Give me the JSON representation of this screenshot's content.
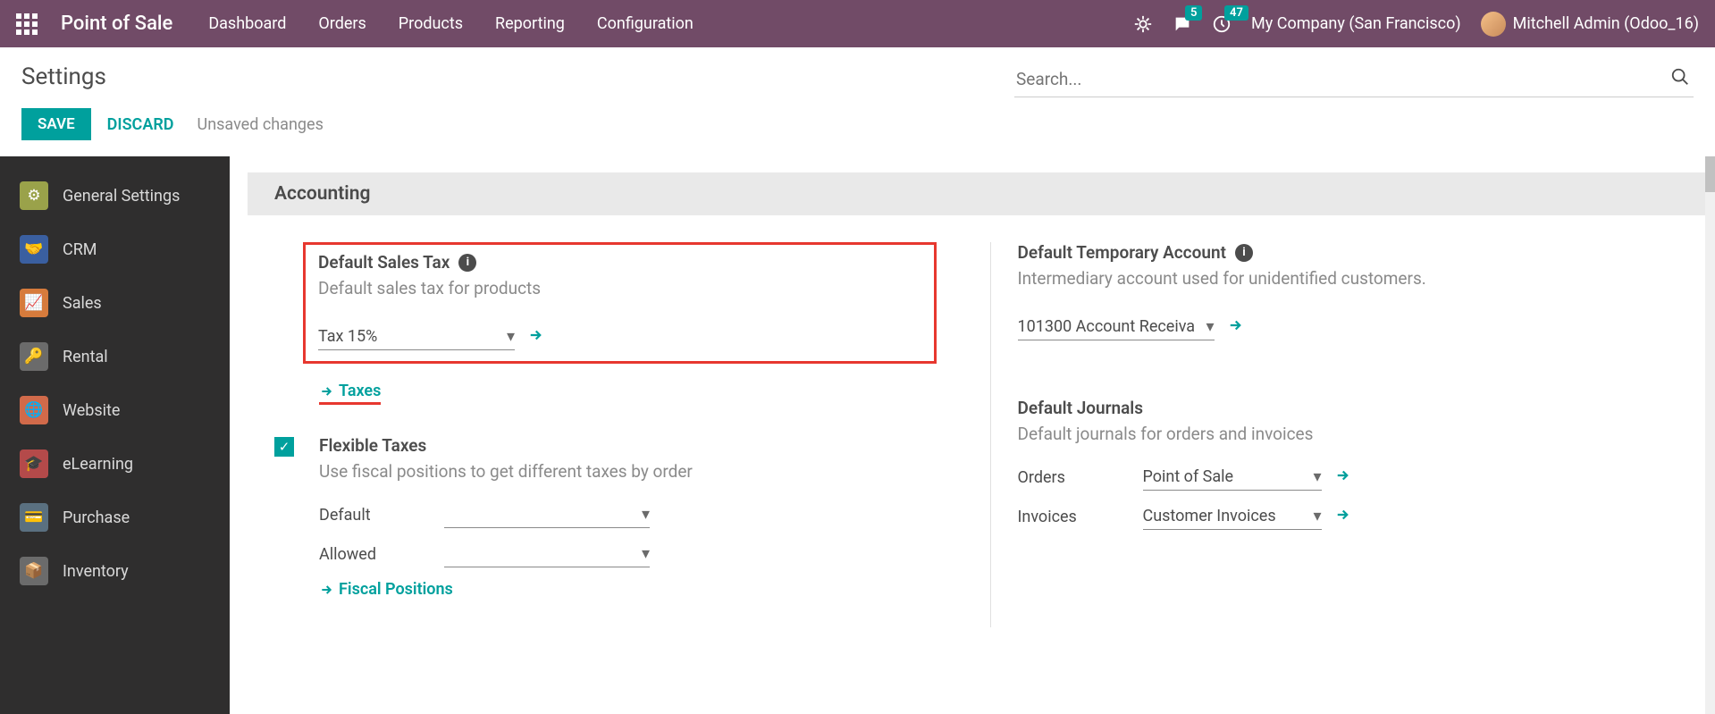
{
  "topbar": {
    "brand": "Point of Sale",
    "nav": [
      "Dashboard",
      "Orders",
      "Products",
      "Reporting",
      "Configuration"
    ],
    "msg_badge": "5",
    "activity_badge": "47",
    "company": "My Company (San Francisco)",
    "user": "Mitchell Admin (Odoo_16)"
  },
  "header": {
    "title": "Settings",
    "search_placeholder": "Search..."
  },
  "actions": {
    "save": "SAVE",
    "discard": "DISCARD",
    "unsaved": "Unsaved changes"
  },
  "sidebar": [
    {
      "label": "General Settings",
      "color": "#9aa24a"
    },
    {
      "label": "CRM",
      "color": "#3a5fa0"
    },
    {
      "label": "Sales",
      "color": "#d67b3c"
    },
    {
      "label": "Rental",
      "color": "#6b6b6b"
    },
    {
      "label": "Website",
      "color": "#d16a4a"
    },
    {
      "label": "eLearning",
      "color": "#b44a4a"
    },
    {
      "label": "Purchase",
      "color": "#5a7080"
    },
    {
      "label": "Inventory",
      "color": "#6b6b6b"
    }
  ],
  "section": {
    "title": "Accounting"
  },
  "settings": {
    "default_sales_tax": {
      "title": "Default Sales Tax",
      "desc": "Default sales tax for products",
      "value": "Tax 15%",
      "link": "Taxes"
    },
    "default_temp_account": {
      "title": "Default Temporary Account",
      "desc": "Intermediary account used for unidentified customers.",
      "value": "101300 Account Receiva"
    },
    "flexible_taxes": {
      "title": "Flexible Taxes",
      "desc": "Use fiscal positions to get different taxes by order",
      "default_label": "Default",
      "allowed_label": "Allowed",
      "default_value": "",
      "allowed_value": "",
      "link": "Fiscal Positions"
    },
    "default_journals": {
      "title": "Default Journals",
      "desc": "Default journals for orders and invoices",
      "orders_label": "Orders",
      "invoices_label": "Invoices",
      "orders_value": "Point of Sale",
      "invoices_value": "Customer Invoices"
    }
  }
}
